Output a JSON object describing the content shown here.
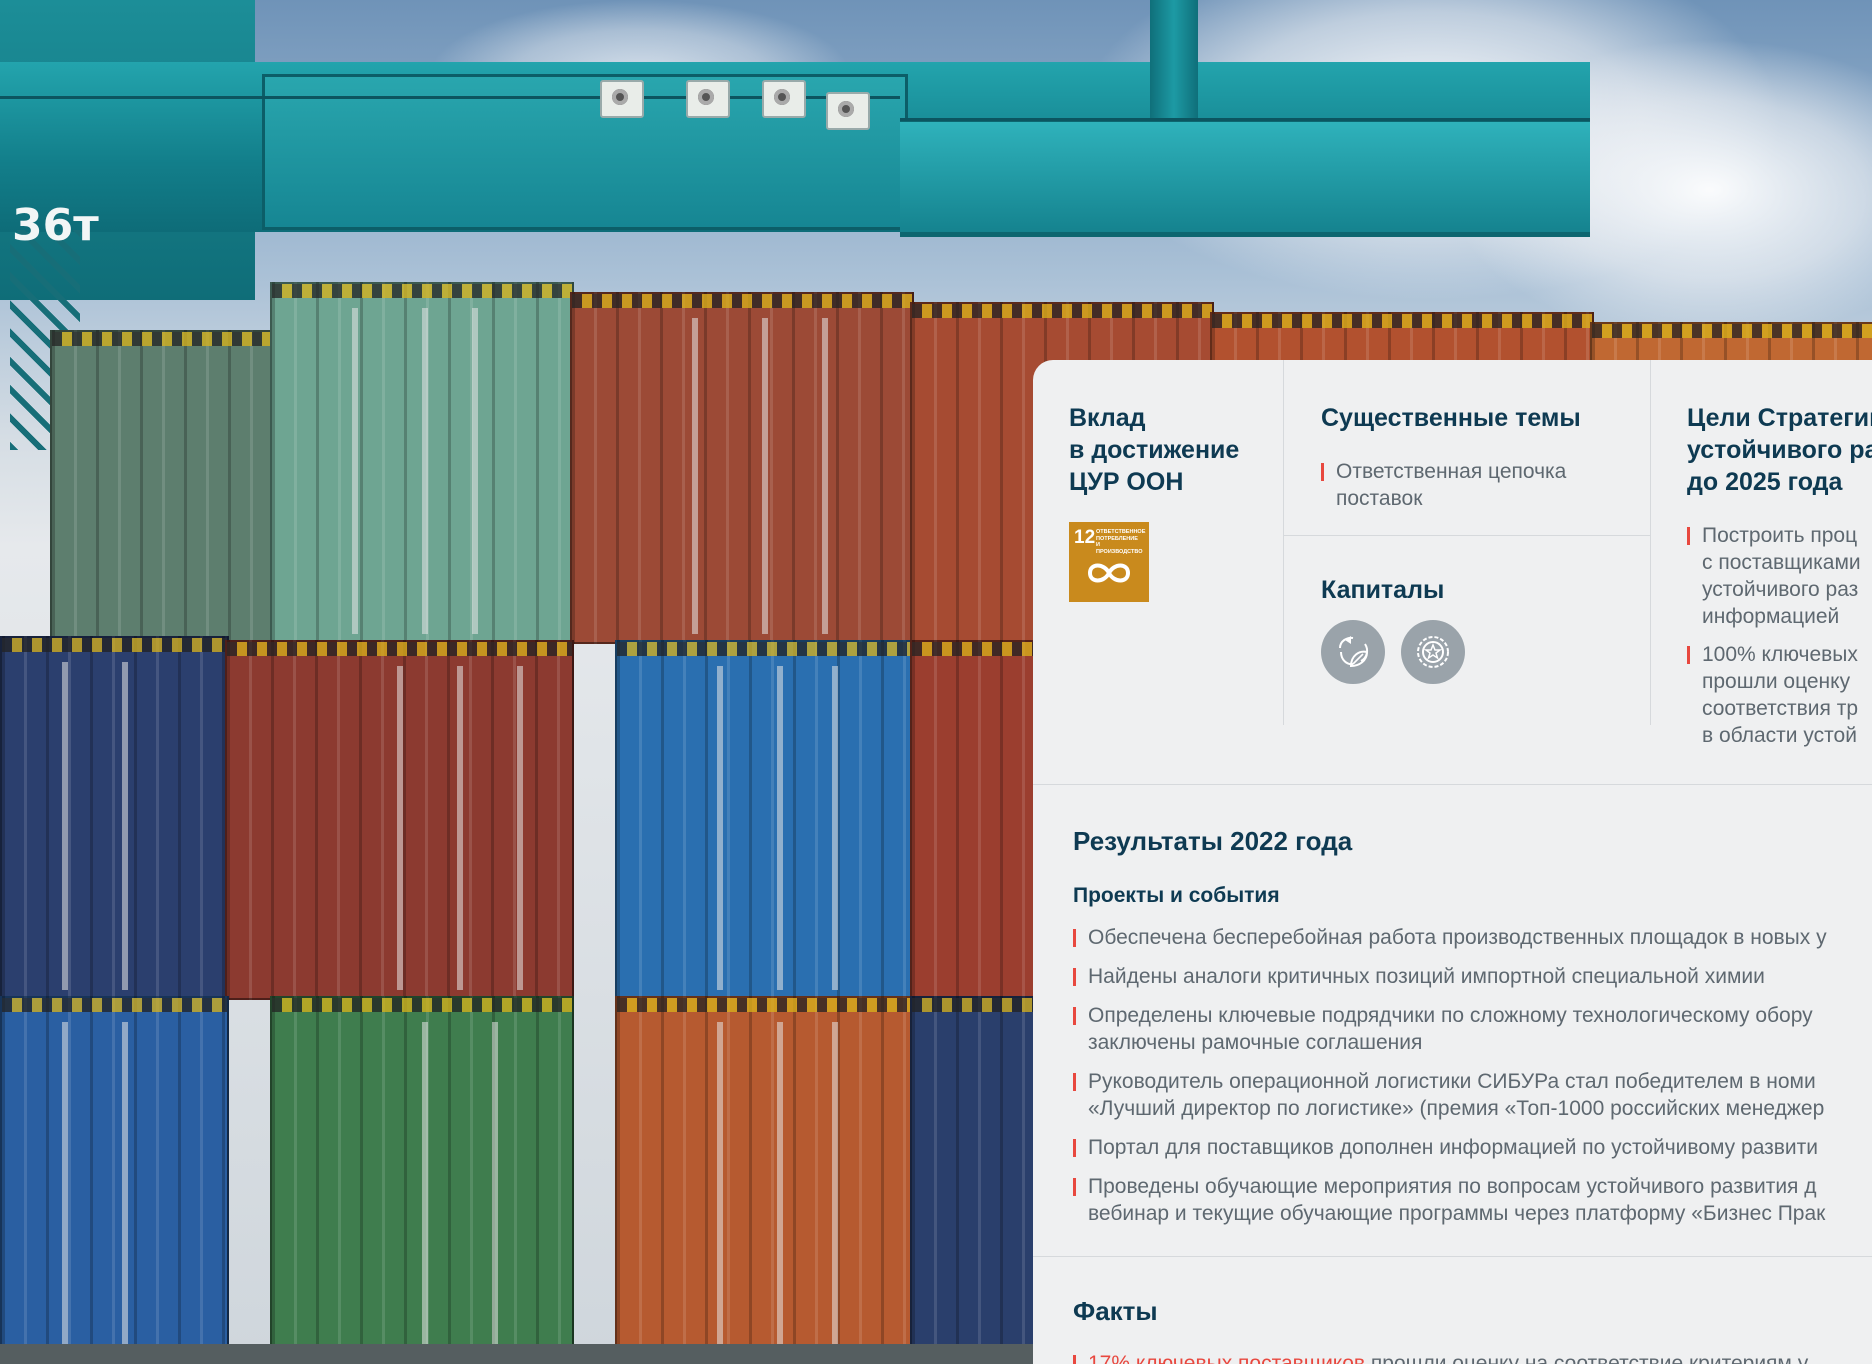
{
  "photo": {
    "crane_label": "36т"
  },
  "panel": {
    "sdg_column": {
      "title": [
        "Вклад",
        "в достижение",
        "ЦУР ООН"
      ],
      "sdg_goal": {
        "number": "12",
        "caption": [
          "ОТВЕТСТВЕННОЕ",
          "ПОТРЕБЛЕНИЕ",
          "И ПРОИЗВОДСТВО"
        ],
        "color": "#c98a1d",
        "icon": "infinity-icon"
      }
    },
    "topics_column": {
      "title": "Существенные темы",
      "items": [
        "Ответственная цепочка",
        "поставок"
      ]
    },
    "capitals_column": {
      "title": "Капиталы",
      "icons": [
        "recycle-leaf-icon",
        "badge-star-icon"
      ]
    },
    "goals_column": {
      "title": [
        "Цели Стратегии",
        "устойчивого ра",
        "до 2025 года"
      ],
      "items": [
        [
          "Построить проц",
          "с поставщиками",
          "устойчивого раз",
          "информацией"
        ],
        [
          "100% ключевых",
          "прошли оценку",
          "соответствия тр",
          "в области устой"
        ]
      ]
    },
    "results": {
      "title": "Результаты 2022 года",
      "subtitle": "Проекты и события",
      "items": [
        [
          "Обеспечена бесперебойная работа производственных площадок в новых у"
        ],
        [
          "Найдены аналоги критичных позиций импортной специальной химии"
        ],
        [
          "Определены ключевые подрядчики по сложному технологическому обору",
          "заключены рамочные соглашения"
        ],
        [
          "Руководитель операционной логистики СИБУРа стал победителем в номи",
          "«Лучший директор по логистике» (премия «Топ-1000 российских менеджер"
        ],
        [
          "Портал для поставщиков дополнен информацией по устойчивому развити"
        ],
        [
          "Проведены обучающие мероприятия по вопросам устойчивого развития д",
          "вебинар и текущие обучающие программы через платформу «Бизнес Прак"
        ]
      ]
    },
    "facts": {
      "title": "Факты",
      "items": [
        {
          "highlight": "17% ключевых поставщиков",
          "text": " прошли оценку на соответствие критериям у"
        }
      ]
    },
    "colors": {
      "heading": "#0e3a52",
      "accent": "#e8483f",
      "body_text": "#5e6870",
      "panel_bg": "#eff0f1"
    }
  }
}
